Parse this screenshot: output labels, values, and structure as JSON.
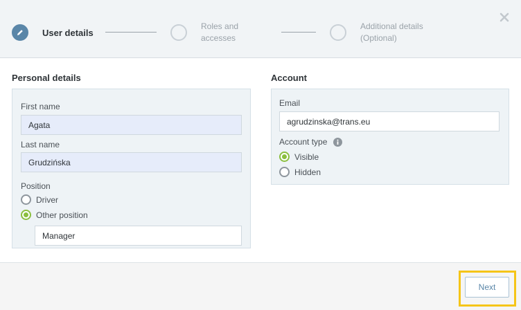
{
  "stepper": {
    "steps": [
      {
        "label": "User details",
        "state": "active",
        "icon": "pencil-icon"
      },
      {
        "label_line1": "Roles and",
        "label_line2": "accesses",
        "state": "pending"
      },
      {
        "label_line1": "Additional details",
        "label_line2": "(Optional)",
        "state": "pending"
      }
    ],
    "close_icon": "close-icon"
  },
  "personal": {
    "title": "Personal details",
    "first_name_label": "First name",
    "first_name_value": "Agata",
    "last_name_label": "Last name",
    "last_name_value": "Grudzińska",
    "position_label": "Position",
    "position_options": [
      {
        "label": "Driver",
        "checked": false
      },
      {
        "label": "Other position",
        "checked": true
      }
    ],
    "other_position_value": "Manager"
  },
  "account": {
    "title": "Account",
    "email_label": "Email",
    "email_value": "agrudzinska@trans.eu",
    "account_type_label": "Account type",
    "account_type_options": [
      {
        "label": "Visible",
        "checked": true
      },
      {
        "label": "Hidden",
        "checked": false
      }
    ]
  },
  "footer": {
    "next_label": "Next"
  },
  "colors": {
    "accent": "#5a86a8",
    "radio_checked": "#8bbf3f",
    "highlight": "#f5c518"
  }
}
